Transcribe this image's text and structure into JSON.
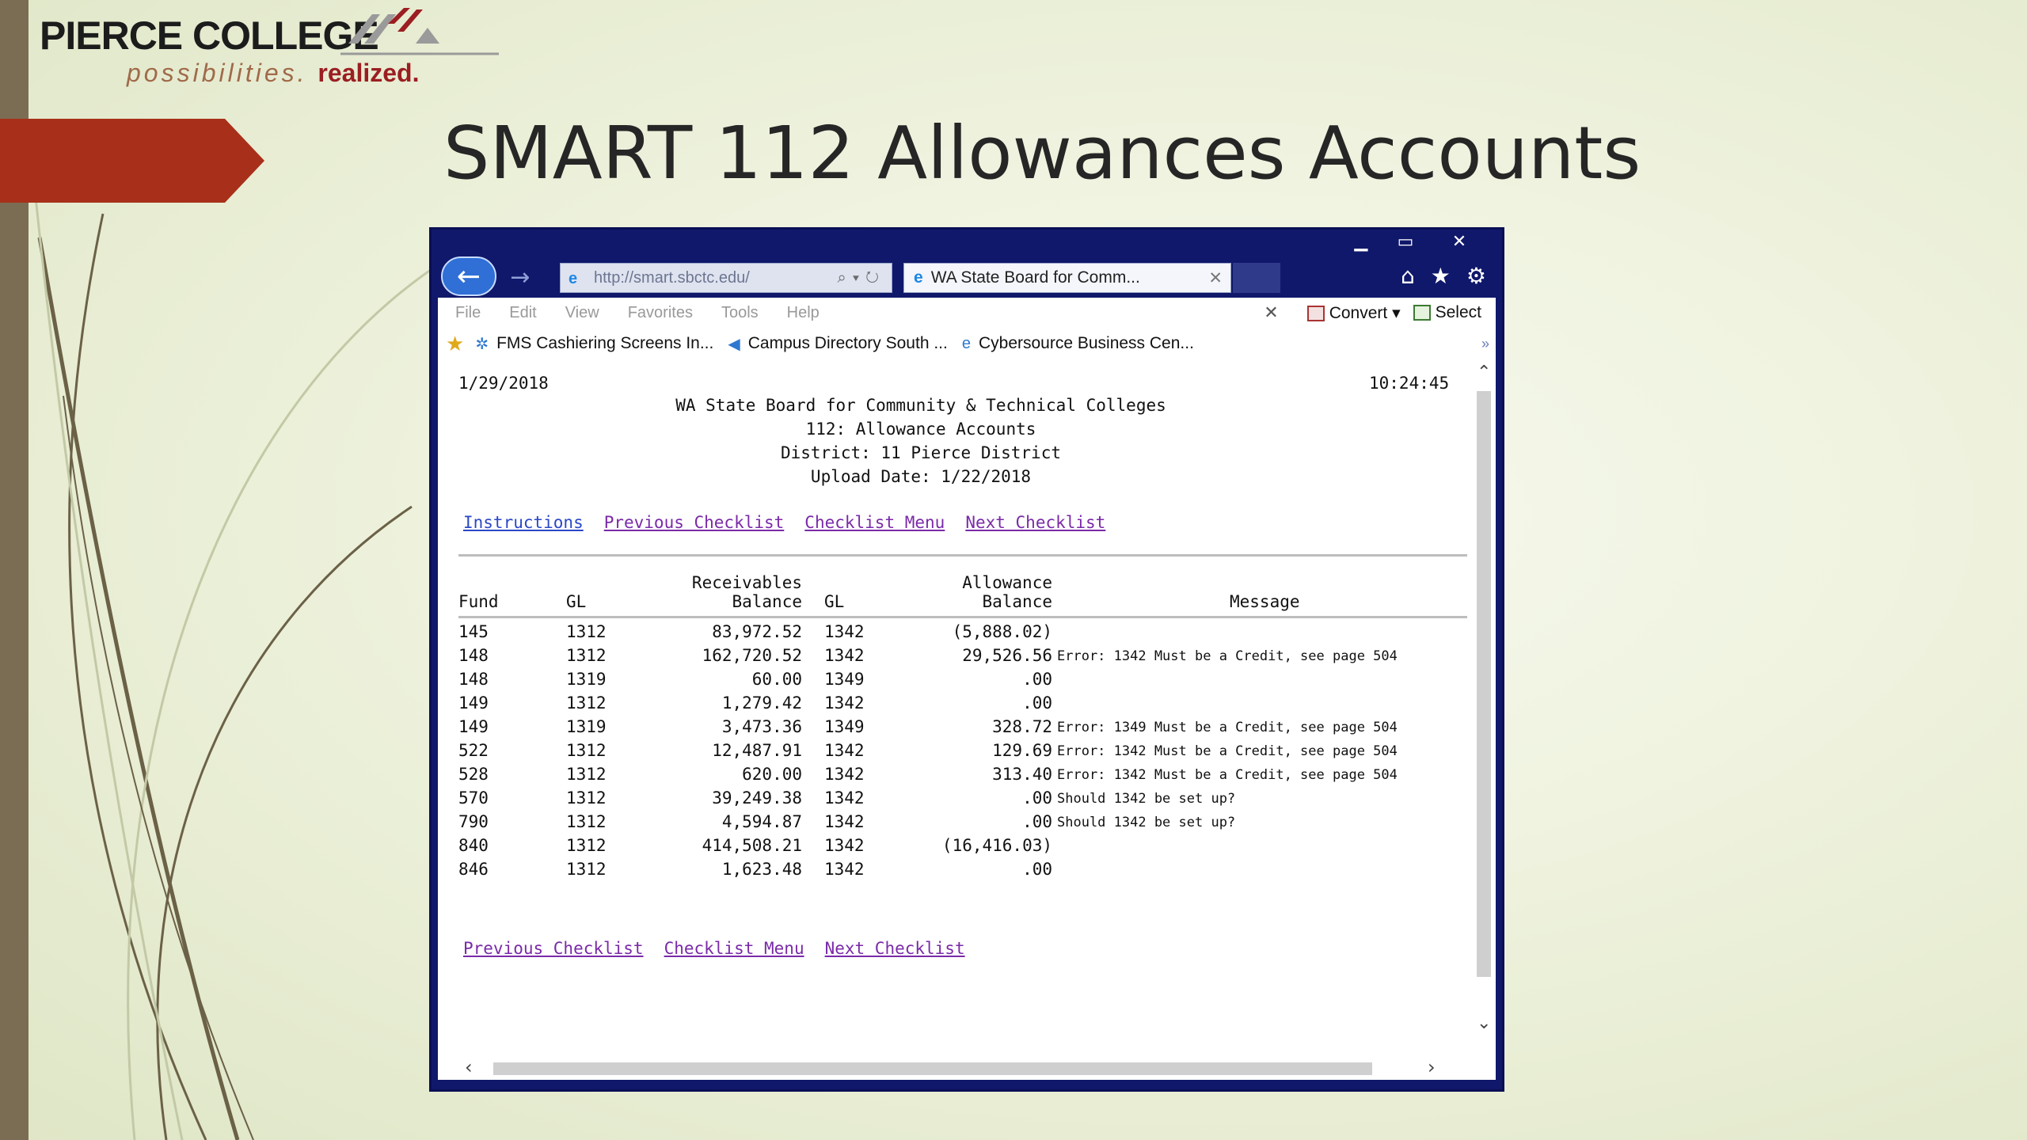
{
  "logo": {
    "name": "PIERCE COLLEGE",
    "tagline": "possibilities.",
    "tagline_bold": "realized."
  },
  "slide": {
    "title": "SMART 112 Allowances Accounts"
  },
  "browser": {
    "address": "http://smart.sbctc.edu/",
    "tab_title": "WA State Board for Comm...",
    "menu": [
      "File",
      "Edit",
      "View",
      "Favorites",
      "Tools",
      "Help"
    ],
    "convert_label": "Convert",
    "select_label": "Select",
    "favorites": [
      "FMS Cashiering Screens In...",
      "Campus Directory  South ...",
      "Cybersource Business Cen..."
    ]
  },
  "report": {
    "date": "1/29/2018",
    "time": "10:24:45",
    "header_lines": [
      "WA State Board for Community & Technical Colleges",
      "112: Allowance Accounts",
      "District: 11  Pierce District",
      "Upload Date: 1/22/2018"
    ],
    "top_links": [
      "Instructions",
      "Previous Checklist",
      "Checklist Menu",
      "Next Checklist"
    ],
    "bottom_links": [
      "Previous Checklist",
      "Checklist Menu",
      "Next Checklist"
    ],
    "columns": {
      "fund": "Fund",
      "gl": "GL",
      "receivables_top": "Receivables",
      "receivables_bottom": "Balance",
      "gl2": "GL",
      "allowance_top": "Allowance",
      "allowance_bottom": "Balance",
      "message": "Message"
    },
    "rows": [
      {
        "fund": "145",
        "gl": "1312",
        "receivables": "83,972.52",
        "gl2": "1342",
        "allowance": "(5,888.02)",
        "message": ""
      },
      {
        "fund": "148",
        "gl": "1312",
        "receivables": "162,720.52",
        "gl2": "1342",
        "allowance": "29,526.56",
        "message": "Error: 1342 Must be a Credit, see page 504"
      },
      {
        "fund": "148",
        "gl": "1319",
        "receivables": "60.00",
        "gl2": "1349",
        "allowance": ".00",
        "message": ""
      },
      {
        "fund": "149",
        "gl": "1312",
        "receivables": "1,279.42",
        "gl2": "1342",
        "allowance": ".00",
        "message": ""
      },
      {
        "fund": "149",
        "gl": "1319",
        "receivables": "3,473.36",
        "gl2": "1349",
        "allowance": "328.72",
        "message": "Error: 1349 Must be a Credit, see page 504"
      },
      {
        "fund": "522",
        "gl": "1312",
        "receivables": "12,487.91",
        "gl2": "1342",
        "allowance": "129.69",
        "message": "Error: 1342 Must be a Credit, see page 504"
      },
      {
        "fund": "528",
        "gl": "1312",
        "receivables": "620.00",
        "gl2": "1342",
        "allowance": "313.40",
        "message": "Error: 1342 Must be a Credit, see page 504"
      },
      {
        "fund": "570",
        "gl": "1312",
        "receivables": "39,249.38",
        "gl2": "1342",
        "allowance": ".00",
        "message": "Should 1342 be set up?"
      },
      {
        "fund": "790",
        "gl": "1312",
        "receivables": "4,594.87",
        "gl2": "1342",
        "allowance": ".00",
        "message": "Should 1342 be set up?"
      },
      {
        "fund": "840",
        "gl": "1312",
        "receivables": "414,508.21",
        "gl2": "1342",
        "allowance": "(16,416.03)",
        "message": ""
      },
      {
        "fund": "846",
        "gl": "1312",
        "receivables": "1,623.48",
        "gl2": "1342",
        "allowance": ".00",
        "message": ""
      }
    ]
  },
  "colors": {
    "accent_red": "#a8301a",
    "left_bar": "#7b6d53",
    "window_frame": "#10186b",
    "visited_link": "#7a2aa8",
    "link": "#2a47c8"
  }
}
